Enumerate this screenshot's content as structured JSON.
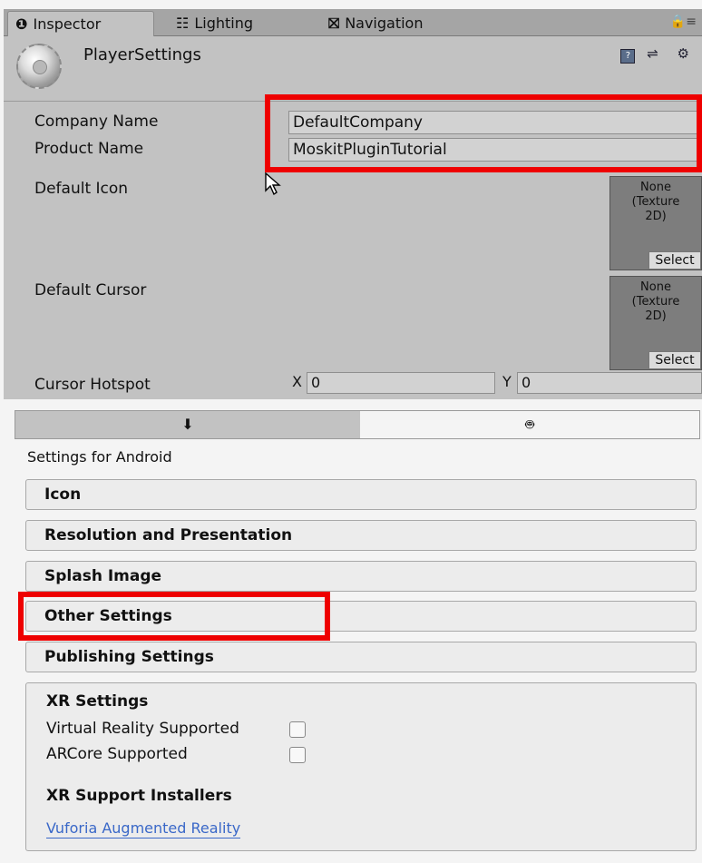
{
  "tabs": [
    {
      "icon": "info-icon",
      "glyph": "❶",
      "label": "Inspector"
    },
    {
      "icon": "lighting-icon",
      "glyph": "☷",
      "label": "Lighting"
    },
    {
      "icon": "navigation-icon",
      "glyph": "⛝",
      "label": "Navigation"
    }
  ],
  "header": {
    "title": "PlayerSettings"
  },
  "fields": {
    "company_label": "Company Name",
    "company_value": "DefaultCompany",
    "product_label": "Product Name",
    "product_value": "MoskitPluginTutorial",
    "default_icon_label": "Default Icon",
    "default_cursor_label": "Default Cursor",
    "cursor_hotspot_label": "Cursor Hotspot",
    "hotspot_x_label": "X",
    "hotspot_x_value": "0",
    "hotspot_y_label": "Y",
    "hotspot_y_value": "0"
  },
  "texture_slot": {
    "line1": "None",
    "line2": "(Texture",
    "line3": "2D)",
    "select": "Select"
  },
  "platforms": {
    "standalone_icon": "download-icon",
    "android_icon": "android-icon",
    "active": "android"
  },
  "settings_for": "Settings for Android",
  "sections": [
    "Icon",
    "Resolution and Presentation",
    "Splash Image",
    "Other Settings",
    "Publishing Settings"
  ],
  "xr": {
    "title": "XR Settings",
    "vr_label": "Virtual Reality Supported",
    "arcore_label": "ARCore Supported",
    "installers_title": "XR Support Installers",
    "vuforia_link": "Vuforia Augmented Reality"
  },
  "colors": {
    "highlight": "#ee0000",
    "link": "#3a68c8",
    "panel": "#c2c2c2"
  }
}
